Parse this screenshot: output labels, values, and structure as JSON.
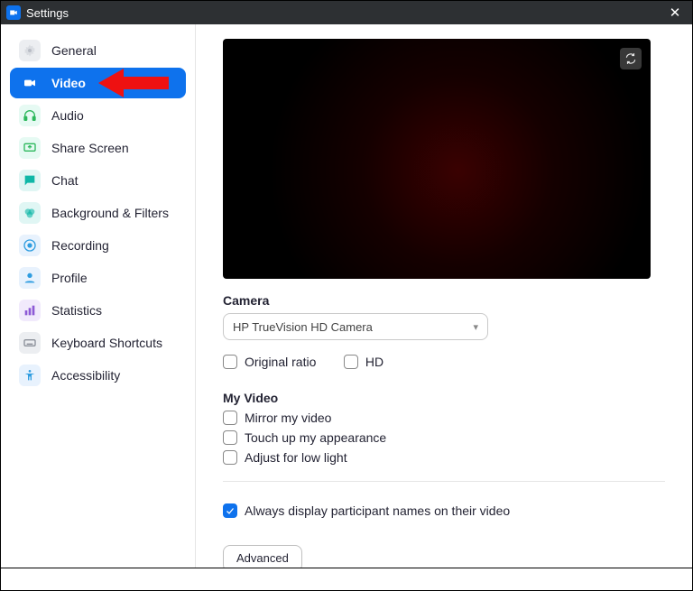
{
  "window": {
    "title": "Settings"
  },
  "sidebar": {
    "items": [
      {
        "id": "general",
        "label": "General"
      },
      {
        "id": "video",
        "label": "Video"
      },
      {
        "id": "audio",
        "label": "Audio"
      },
      {
        "id": "share",
        "label": "Share Screen"
      },
      {
        "id": "chat",
        "label": "Chat"
      },
      {
        "id": "bgfilters",
        "label": "Background & Filters"
      },
      {
        "id": "recording",
        "label": "Recording"
      },
      {
        "id": "profile",
        "label": "Profile"
      },
      {
        "id": "statistics",
        "label": "Statistics"
      },
      {
        "id": "shortcuts",
        "label": "Keyboard Shortcuts"
      },
      {
        "id": "a11y",
        "label": "Accessibility"
      }
    ],
    "active_id": "video"
  },
  "video": {
    "camera_section": "Camera",
    "camera_selected": "HP TrueVision HD Camera",
    "opts": {
      "original_ratio": "Original ratio",
      "hd": "HD"
    },
    "myvideo_section": "My Video",
    "mirror": "Mirror my video",
    "touchup": "Touch up my appearance",
    "lowlight": "Adjust for low light",
    "always_names": "Always display participant names on their video",
    "advanced": "Advanced"
  },
  "colors": {
    "accent": "#0e72ed",
    "icon_teal": "#0fb7a7",
    "icon_green": "#2db85c",
    "icon_purple": "#8d5ad6",
    "icon_blue2": "#2f9de0",
    "icon_grey": "#b9bec6"
  }
}
